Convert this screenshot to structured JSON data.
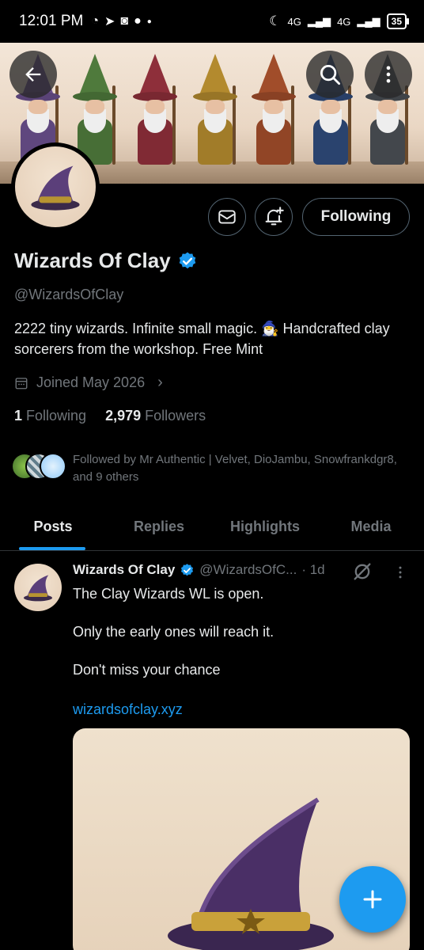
{
  "status_bar": {
    "time": "12:01 PM",
    "network_1": "4G",
    "network_2": "4G",
    "battery": "35"
  },
  "header": {
    "back_icon": "arrow-left-icon",
    "search_icon": "search-icon",
    "more_icon": "more-vertical-icon"
  },
  "banner": {
    "wizard_colors": [
      "#6a4f8c",
      "#4f7a3c",
      "#8e2f3a",
      "#b38a2e",
      "#a14d2a",
      "#2f4a7a",
      "#4a4f55"
    ]
  },
  "profile": {
    "name": "Wizards Of Clay",
    "handle": "@WizardsOfClay",
    "bio": "2222 tiny wizards. Infinite small magic. 🧙‍♂️  Handcrafted clay sorcerers from the workshop.  Free Mint",
    "joined": "Joined May 2026",
    "following_count": "1",
    "following_label": "Following",
    "followers_count": "2,979",
    "followers_label": "Followers",
    "followed_by": "Followed by Mr Authentic | Velvet, DioJambu, Snowfrankdgr8, and 9 others",
    "follow_button": "Following",
    "verified_color": "#1d9bf0"
  },
  "tabs": [
    {
      "label": "Posts",
      "active": true
    },
    {
      "label": "Replies",
      "active": false
    },
    {
      "label": "Highlights",
      "active": false
    },
    {
      "label": "Media",
      "active": false
    }
  ],
  "post": {
    "name": "Wizards Of Clay",
    "handle": "@WizardsOfC...",
    "time": "· 1d",
    "lines": [
      "The Clay Wizards WL is open.",
      "Only the early ones will reach it.",
      "Don't miss your chance"
    ],
    "link": "wizardsofclay.xyz"
  },
  "fab": {
    "icon": "plus-icon"
  },
  "colors": {
    "accent": "#1d9bf0",
    "muted": "#71767b",
    "text": "#e7e9ea",
    "background": "#000000"
  }
}
